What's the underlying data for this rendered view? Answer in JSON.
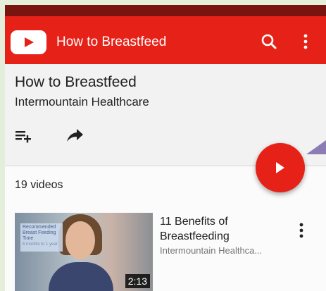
{
  "app_bar": {
    "title": "How to Breastfeed",
    "icons": [
      "youtube-logo-icon",
      "search-icon",
      "more-vert-icon"
    ],
    "color": "#e62117"
  },
  "playlist": {
    "title": "How to Breastfeed",
    "channel": "Intermountain Healthcare",
    "actions": [
      "add-to-queue-icon",
      "share-icon"
    ],
    "play_all_icon": "play-icon"
  },
  "video_count": "19 videos",
  "videos": [
    {
      "title": "11 Benefits of Breastfeeding",
      "channel": "Intermountain Healthca...",
      "duration": "2:13",
      "thumbnail_overlay": {
        "line1": "Recommended Breast Feeding Time",
        "line2": "6 months to 1 year"
      }
    }
  ]
}
